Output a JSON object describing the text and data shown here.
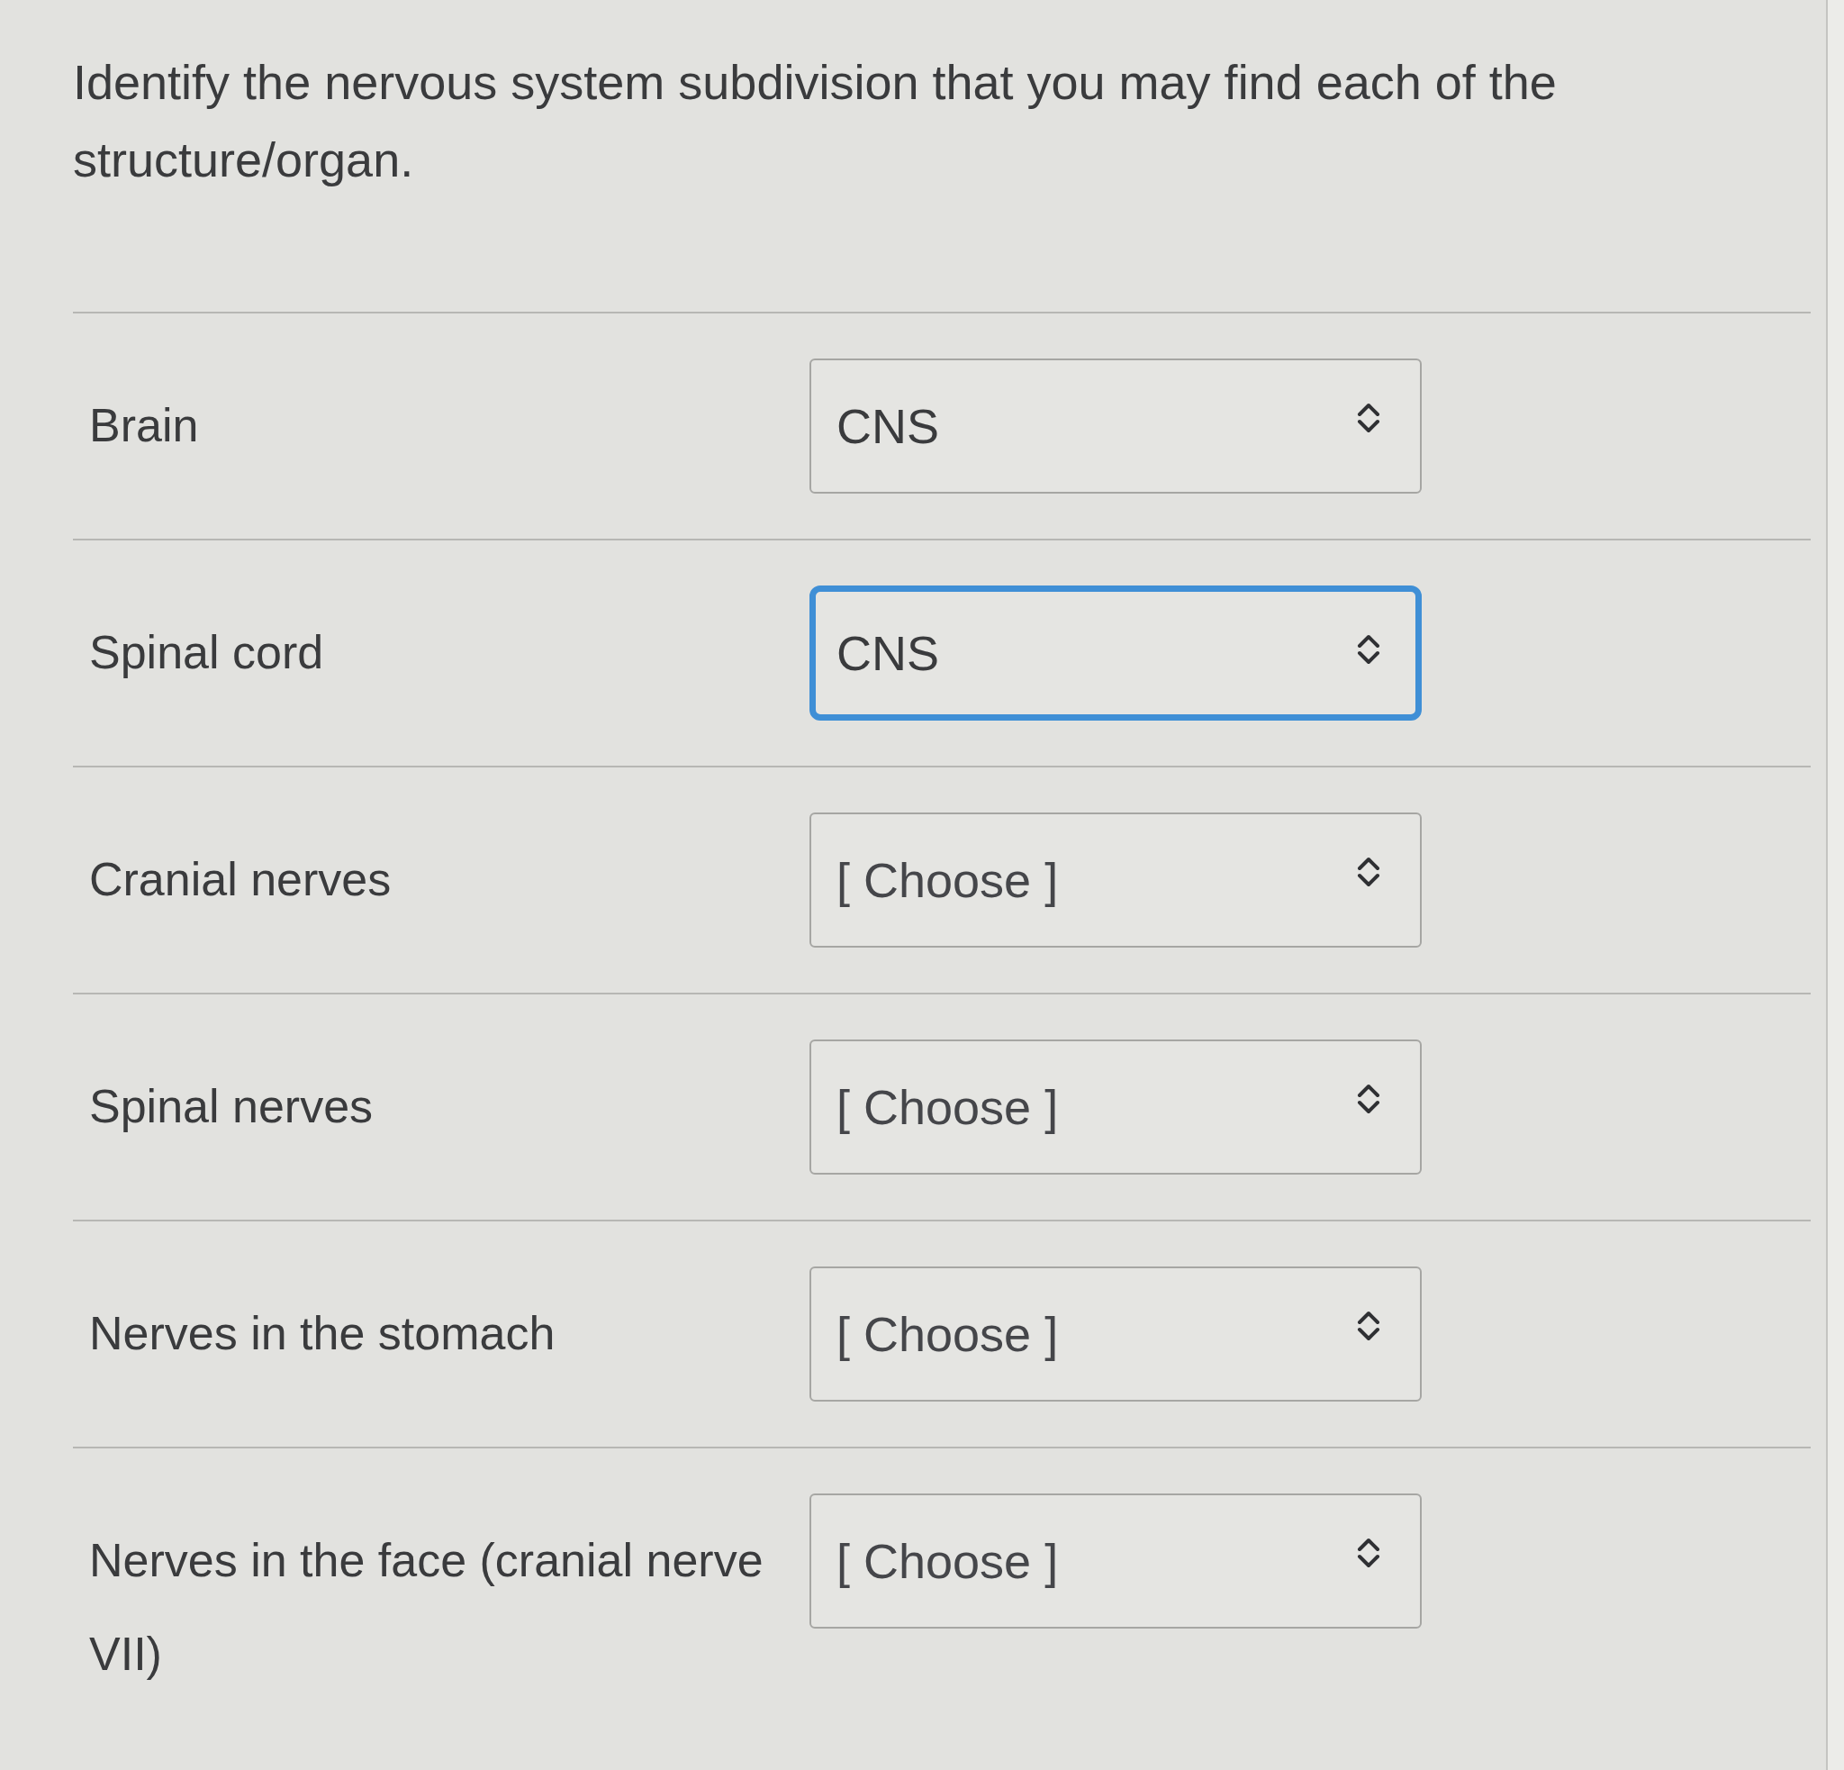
{
  "question": "Identify the nervous system subdivision that you may find each of the structure/organ.",
  "rows": [
    {
      "label": "Brain",
      "dropdown": {
        "value": "CNS",
        "focused": false
      }
    },
    {
      "label": "Spinal cord",
      "dropdown": {
        "value": "CNS",
        "focused": true
      }
    },
    {
      "label": "Cranial nerves",
      "dropdown": {
        "placeholder": "[ Choose ]",
        "focused": false
      }
    },
    {
      "label": "Spinal nerves",
      "dropdown": {
        "placeholder": "[ Choose ]",
        "focused": false
      }
    },
    {
      "label": "Nerves in the stomach",
      "dropdown": {
        "placeholder": "[ Choose ]",
        "focused": false
      }
    },
    {
      "label": "Nerves in the face (cranial nerve VII)",
      "dropdown": {
        "placeholder": "[ Choose ]",
        "focused": false
      }
    }
  ]
}
